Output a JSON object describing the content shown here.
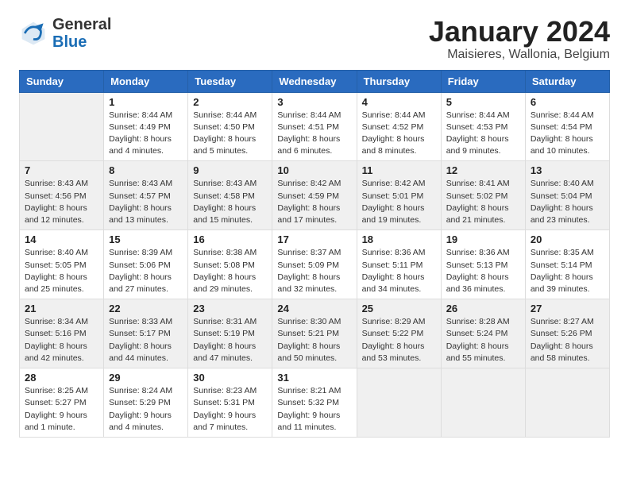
{
  "header": {
    "logo_general": "General",
    "logo_blue": "Blue",
    "month_title": "January 2024",
    "subtitle": "Maisieres, Wallonia, Belgium"
  },
  "weekdays": [
    "Sunday",
    "Monday",
    "Tuesday",
    "Wednesday",
    "Thursday",
    "Friday",
    "Saturday"
  ],
  "weeks": [
    [
      {
        "day": "",
        "info": ""
      },
      {
        "day": "1",
        "info": "Sunrise: 8:44 AM\nSunset: 4:49 PM\nDaylight: 8 hours\nand 4 minutes."
      },
      {
        "day": "2",
        "info": "Sunrise: 8:44 AM\nSunset: 4:50 PM\nDaylight: 8 hours\nand 5 minutes."
      },
      {
        "day": "3",
        "info": "Sunrise: 8:44 AM\nSunset: 4:51 PM\nDaylight: 8 hours\nand 6 minutes."
      },
      {
        "day": "4",
        "info": "Sunrise: 8:44 AM\nSunset: 4:52 PM\nDaylight: 8 hours\nand 8 minutes."
      },
      {
        "day": "5",
        "info": "Sunrise: 8:44 AM\nSunset: 4:53 PM\nDaylight: 8 hours\nand 9 minutes."
      },
      {
        "day": "6",
        "info": "Sunrise: 8:44 AM\nSunset: 4:54 PM\nDaylight: 8 hours\nand 10 minutes."
      }
    ],
    [
      {
        "day": "7",
        "info": "Sunrise: 8:43 AM\nSunset: 4:56 PM\nDaylight: 8 hours\nand 12 minutes."
      },
      {
        "day": "8",
        "info": "Sunrise: 8:43 AM\nSunset: 4:57 PM\nDaylight: 8 hours\nand 13 minutes."
      },
      {
        "day": "9",
        "info": "Sunrise: 8:43 AM\nSunset: 4:58 PM\nDaylight: 8 hours\nand 15 minutes."
      },
      {
        "day": "10",
        "info": "Sunrise: 8:42 AM\nSunset: 4:59 PM\nDaylight: 8 hours\nand 17 minutes."
      },
      {
        "day": "11",
        "info": "Sunrise: 8:42 AM\nSunset: 5:01 PM\nDaylight: 8 hours\nand 19 minutes."
      },
      {
        "day": "12",
        "info": "Sunrise: 8:41 AM\nSunset: 5:02 PM\nDaylight: 8 hours\nand 21 minutes."
      },
      {
        "day": "13",
        "info": "Sunrise: 8:40 AM\nSunset: 5:04 PM\nDaylight: 8 hours\nand 23 minutes."
      }
    ],
    [
      {
        "day": "14",
        "info": "Sunrise: 8:40 AM\nSunset: 5:05 PM\nDaylight: 8 hours\nand 25 minutes."
      },
      {
        "day": "15",
        "info": "Sunrise: 8:39 AM\nSunset: 5:06 PM\nDaylight: 8 hours\nand 27 minutes."
      },
      {
        "day": "16",
        "info": "Sunrise: 8:38 AM\nSunset: 5:08 PM\nDaylight: 8 hours\nand 29 minutes."
      },
      {
        "day": "17",
        "info": "Sunrise: 8:37 AM\nSunset: 5:09 PM\nDaylight: 8 hours\nand 32 minutes."
      },
      {
        "day": "18",
        "info": "Sunrise: 8:36 AM\nSunset: 5:11 PM\nDaylight: 8 hours\nand 34 minutes."
      },
      {
        "day": "19",
        "info": "Sunrise: 8:36 AM\nSunset: 5:13 PM\nDaylight: 8 hours\nand 36 minutes."
      },
      {
        "day": "20",
        "info": "Sunrise: 8:35 AM\nSunset: 5:14 PM\nDaylight: 8 hours\nand 39 minutes."
      }
    ],
    [
      {
        "day": "21",
        "info": "Sunrise: 8:34 AM\nSunset: 5:16 PM\nDaylight: 8 hours\nand 42 minutes."
      },
      {
        "day": "22",
        "info": "Sunrise: 8:33 AM\nSunset: 5:17 PM\nDaylight: 8 hours\nand 44 minutes."
      },
      {
        "day": "23",
        "info": "Sunrise: 8:31 AM\nSunset: 5:19 PM\nDaylight: 8 hours\nand 47 minutes."
      },
      {
        "day": "24",
        "info": "Sunrise: 8:30 AM\nSunset: 5:21 PM\nDaylight: 8 hours\nand 50 minutes."
      },
      {
        "day": "25",
        "info": "Sunrise: 8:29 AM\nSunset: 5:22 PM\nDaylight: 8 hours\nand 53 minutes."
      },
      {
        "day": "26",
        "info": "Sunrise: 8:28 AM\nSunset: 5:24 PM\nDaylight: 8 hours\nand 55 minutes."
      },
      {
        "day": "27",
        "info": "Sunrise: 8:27 AM\nSunset: 5:26 PM\nDaylight: 8 hours\nand 58 minutes."
      }
    ],
    [
      {
        "day": "28",
        "info": "Sunrise: 8:25 AM\nSunset: 5:27 PM\nDaylight: 9 hours\nand 1 minute."
      },
      {
        "day": "29",
        "info": "Sunrise: 8:24 AM\nSunset: 5:29 PM\nDaylight: 9 hours\nand 4 minutes."
      },
      {
        "day": "30",
        "info": "Sunrise: 8:23 AM\nSunset: 5:31 PM\nDaylight: 9 hours\nand 7 minutes."
      },
      {
        "day": "31",
        "info": "Sunrise: 8:21 AM\nSunset: 5:32 PM\nDaylight: 9 hours\nand 11 minutes."
      },
      {
        "day": "",
        "info": ""
      },
      {
        "day": "",
        "info": ""
      },
      {
        "day": "",
        "info": ""
      }
    ]
  ]
}
